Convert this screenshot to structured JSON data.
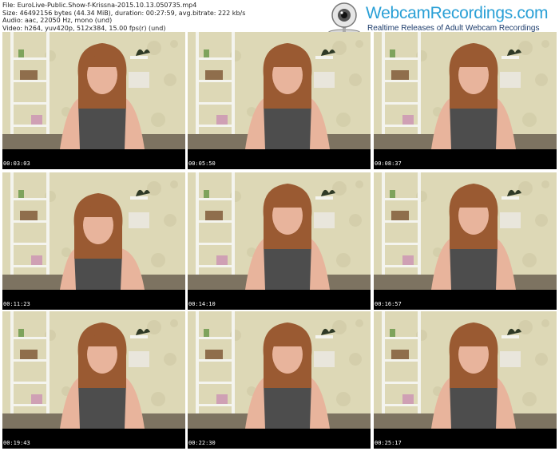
{
  "header": {
    "file_line": "File: EuroLive-Public.Show-f-Krissna-2015.10.13.050735.mp4",
    "size_line": "Size: 46492156 bytes (44.34 MiB), duration: 00:27:59, avg.bitrate: 222 kb/s",
    "audio_line": "Audio: aac, 22050 Hz, mono (und)",
    "video_line": "Video: h264, yuv420p, 512x384, 15.00 fps(r) (und)"
  },
  "logo": {
    "brand": "WebcamRecordings.com",
    "tagline": "Realtime Releases of Adult Webcam Recordings",
    "icon": "webcam-icon"
  },
  "thumbnails": [
    {
      "timestamp": "00:03:03"
    },
    {
      "timestamp": "00:05:50"
    },
    {
      "timestamp": "00:08:37"
    },
    {
      "timestamp": "00:11:23"
    },
    {
      "timestamp": "00:14:10"
    },
    {
      "timestamp": "00:16:57"
    },
    {
      "timestamp": "00:19:43"
    },
    {
      "timestamp": "00:22:30"
    },
    {
      "timestamp": "00:25:17"
    }
  ],
  "colors": {
    "wall": "#ddd8b6",
    "shelf": "#f4f4ee",
    "hair": "#9a5a32",
    "top": "#4d4d4d",
    "skin": "#e8b49c",
    "brand": "#2aa0d6"
  }
}
